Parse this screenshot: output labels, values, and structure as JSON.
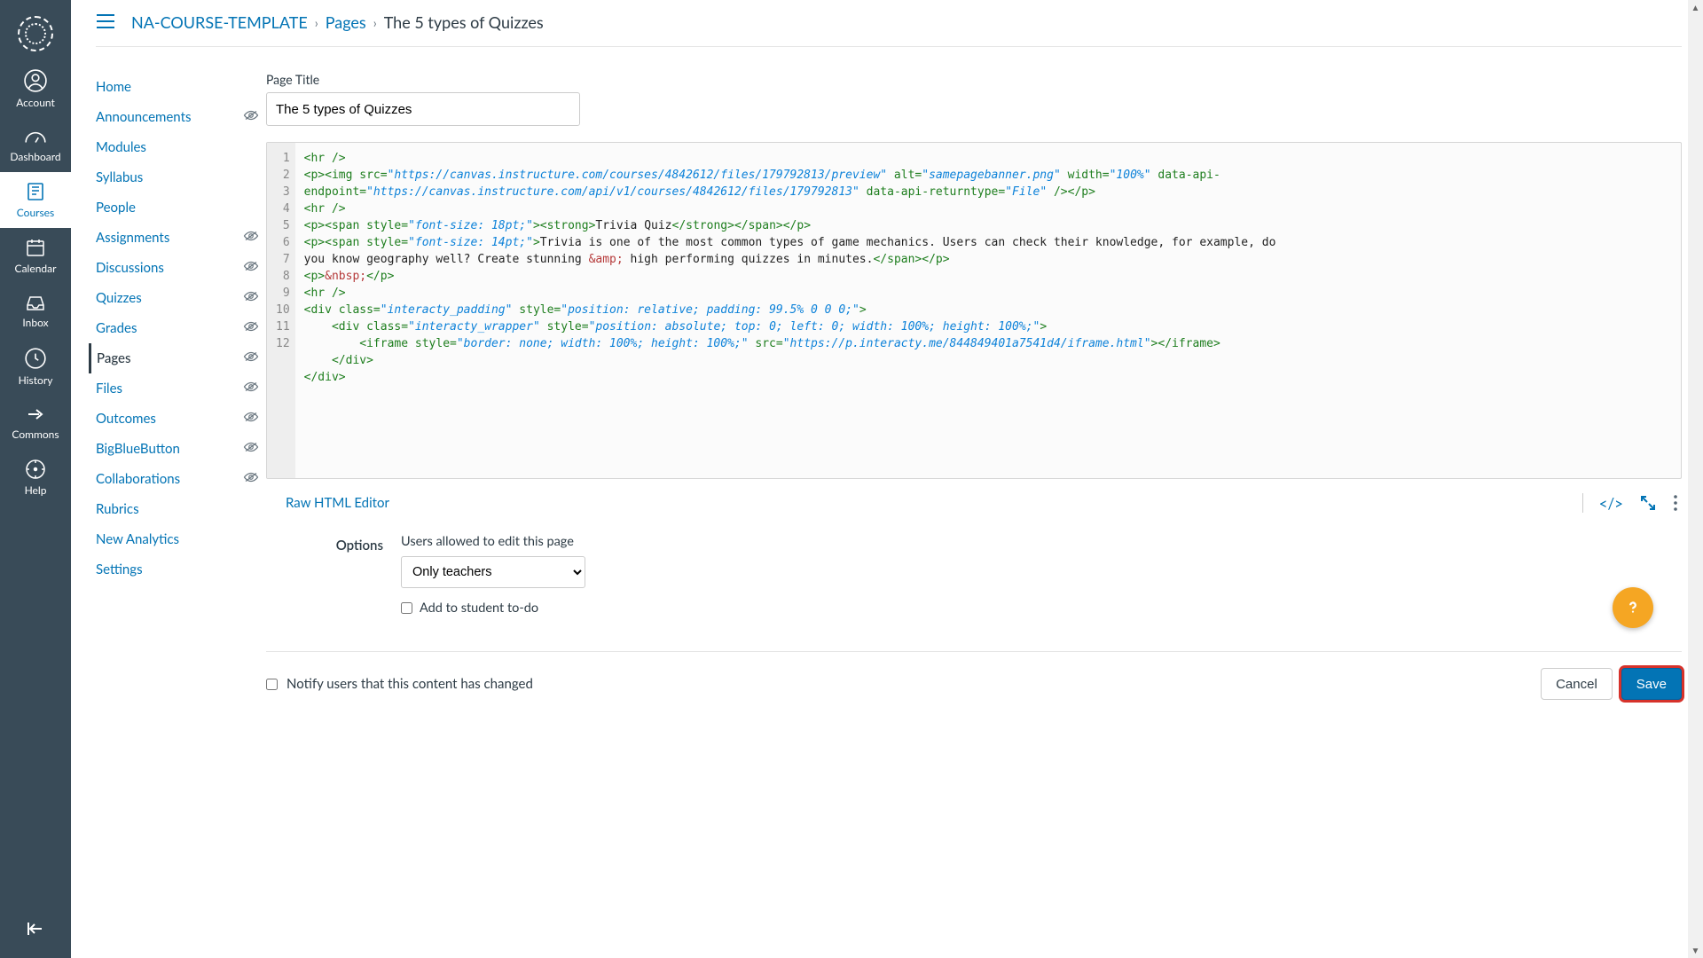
{
  "globalNav": {
    "items": [
      {
        "label": "Account"
      },
      {
        "label": "Dashboard"
      },
      {
        "label": "Courses"
      },
      {
        "label": "Calendar"
      },
      {
        "label": "Inbox"
      },
      {
        "label": "History"
      },
      {
        "label": "Commons"
      },
      {
        "label": "Help"
      }
    ]
  },
  "breadcrumb": {
    "course": "NA-COURSE-TEMPLATE",
    "section": "Pages",
    "page": "The 5 types of Quizzes"
  },
  "courseNav": [
    {
      "label": "Home",
      "hidden": false
    },
    {
      "label": "Announcements",
      "hidden": true
    },
    {
      "label": "Modules",
      "hidden": false
    },
    {
      "label": "Syllabus",
      "hidden": false
    },
    {
      "label": "People",
      "hidden": false
    },
    {
      "label": "Assignments",
      "hidden": true
    },
    {
      "label": "Discussions",
      "hidden": true
    },
    {
      "label": "Quizzes",
      "hidden": true
    },
    {
      "label": "Grades",
      "hidden": true
    },
    {
      "label": "Pages",
      "hidden": true,
      "active": true
    },
    {
      "label": "Files",
      "hidden": true
    },
    {
      "label": "Outcomes",
      "hidden": true
    },
    {
      "label": "BigBlueButton",
      "hidden": true
    },
    {
      "label": "Collaborations",
      "hidden": true
    },
    {
      "label": "Rubrics",
      "hidden": false
    },
    {
      "label": "New Analytics",
      "hidden": false
    },
    {
      "label": "Settings",
      "hidden": false
    }
  ],
  "form": {
    "titleLabel": "Page Title",
    "titleValue": "The 5 types of Quizzes",
    "rawEditorLink": "Raw HTML Editor",
    "optionsLabel": "Options",
    "permDesc": "Users allowed to edit this page",
    "permValue": "Only teachers",
    "todoLabel": "Add to student to-do",
    "notifyLabel": "Notify users that this content has changed",
    "cancel": "Cancel",
    "save": "Save"
  },
  "code": {
    "lines": [
      "1",
      "2",
      "3",
      "4",
      "5",
      "6",
      "7",
      "8",
      "9",
      "10",
      "11",
      "12"
    ],
    "l1": "<hr />",
    "l2a": "<p><img src=",
    "l2_src": "\"https://canvas.instructure.com/courses/4842612/files/179792813/preview\"",
    "l2b": " alt=",
    "l2_alt": "\"samepagebanner.png\"",
    "l2c": " width=",
    "l2_w": "\"100%\"",
    "l2d": " data-api-",
    "l2e": "endpoint=",
    "l2_ep": "\"https://canvas.instructure.com/api/v1/courses/4842612/files/179792813\"",
    "l2f": " data-api-returntype=",
    "l2_rt": "\"File\"",
    "l2g": " /></p>",
    "l3": "<hr />",
    "l4a": "<p><span style=",
    "l4_st": "\"font-size: 18pt;\"",
    "l4b": "><strong>",
    "l4_txt": "Trivia Quiz",
    "l4c": "</strong></span></p>",
    "l5a": "<p><span style=",
    "l5_st": "\"font-size: 14pt;\"",
    "l5b": ">",
    "l5_txt": "Trivia is one of the most common types of game mechanics. Users can check their knowledge, for example, do",
    "l5_txt2": "you know geography well? Create stunning ",
    "l5_amp": "&amp;",
    "l5_txt3": " high performing quizzes in minutes.",
    "l5c": "</span></p>",
    "l6a": "<p>",
    "l6_nb": "&nbsp;",
    "l6b": "</p>",
    "l7": "<hr />",
    "l8a": "<div class=",
    "l8_cl": "\"interacty_padding\"",
    "l8b": " style=",
    "l8_st": "\"position: relative; padding: 99.5% 0 0 0;\"",
    "l8c": ">",
    "l9a": "    <div class=",
    "l9_cl": "\"interacty_wrapper\"",
    "l9b": " style=",
    "l9_st": "\"position: absolute; top: 0; left: 0; width: 100%; height: 100%;\"",
    "l9c": ">",
    "l10a": "        <iframe style=",
    "l10_st": "\"border: none; width: 100%; height: 100%;\"",
    "l10b": " src=",
    "l10_src": "\"https://p.interacty.me/844849401a7541d4/iframe.html\"",
    "l10c": "></iframe>",
    "l11": "    </div>",
    "l12": "</div>"
  }
}
